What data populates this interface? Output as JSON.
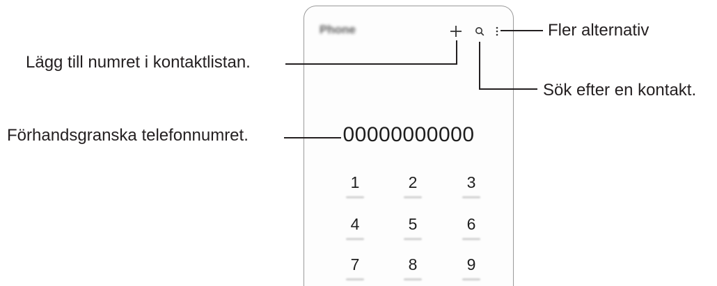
{
  "header": {
    "app_title": "Phone",
    "icons": {
      "add": "plus-icon",
      "search": "search-icon",
      "more": "more-options-icon"
    }
  },
  "dialer": {
    "number_preview": "00000000000",
    "keys": [
      "1",
      "2",
      "3",
      "4",
      "5",
      "6",
      "7",
      "8",
      "9"
    ]
  },
  "callouts": {
    "more_options": "Fler alternativ",
    "add_to_contacts": "Lägg till numret i kontaktlistan.",
    "search_contact": "Sök efter en kontakt.",
    "preview_number": "Förhandsgranska telefonnumret."
  },
  "colors": {
    "text": "#231f20",
    "frame": "#9a9a9a",
    "leader_line": "#231f20"
  }
}
